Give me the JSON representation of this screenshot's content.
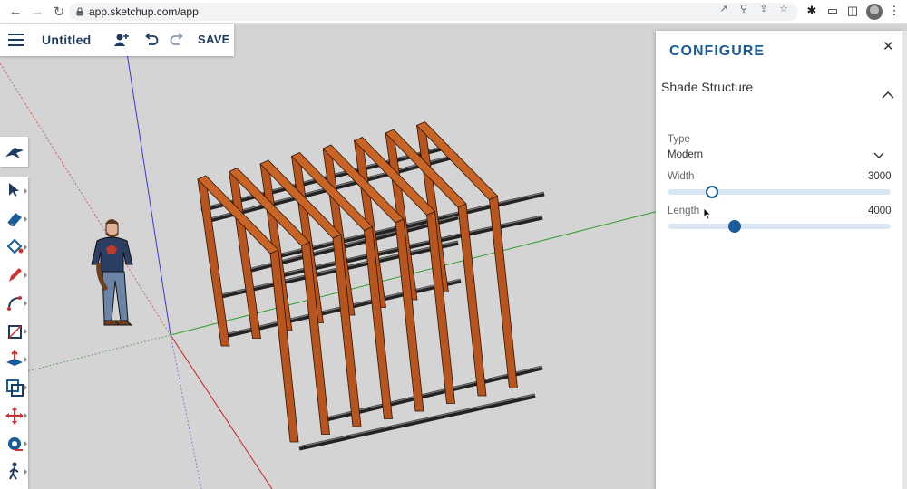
{
  "browser": {
    "url": "app.sketchup.com/app",
    "nav": [
      "back-icon",
      "forward-icon",
      "reload-icon"
    ]
  },
  "toolbar": {
    "title": "Untitled",
    "save_label": "SAVE"
  },
  "tools": [
    "select-icon",
    "eraser-icon",
    "paint-bucket-icon",
    "pencil-icon",
    "arc-icon",
    "rectangle-icon",
    "push-pull-icon",
    "offset-icon",
    "move-icon",
    "tape-measure-icon",
    "walk-icon"
  ],
  "panel": {
    "title": "CONFIGURE",
    "section": "Shade Structure",
    "type_label": "Type",
    "type_value": "Modern",
    "width_label": "Width",
    "width_value": "3000",
    "length_label": "Length",
    "length_value": "4000",
    "width_fraction": 0.2,
    "length_fraction": 0.3
  },
  "colors": {
    "accent": "#1a5c9a",
    "brand_dark": "#1e3a5f",
    "slider_track": "#d9e6f3",
    "beam": "#b8541d"
  }
}
